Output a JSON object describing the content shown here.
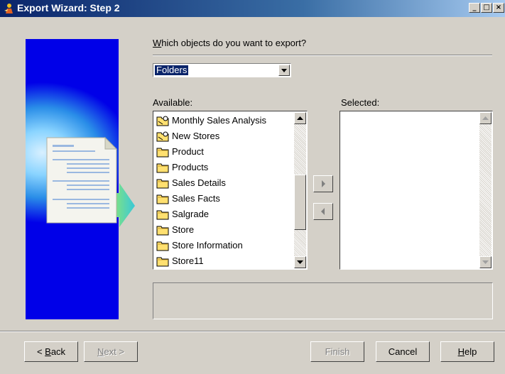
{
  "window": {
    "title": "Export Wizard: Step 2",
    "controls": [
      "minimize",
      "maximize",
      "close"
    ]
  },
  "question": {
    "underline_char": "W",
    "rest": "hich objects do you want to export?"
  },
  "object_type_select": {
    "value": "Folders"
  },
  "available": {
    "label": "Available:",
    "items": [
      {
        "label": "Monthly Sales Analysis",
        "icon": "shared-folder-icon"
      },
      {
        "label": "New Stores",
        "icon": "shared-folder-icon"
      },
      {
        "label": "Product",
        "icon": "folder-icon"
      },
      {
        "label": "Products",
        "icon": "folder-icon"
      },
      {
        "label": "Sales Details",
        "icon": "folder-icon"
      },
      {
        "label": "Sales Facts",
        "icon": "folder-icon"
      },
      {
        "label": "Salgrade",
        "icon": "folder-icon"
      },
      {
        "label": "Store",
        "icon": "folder-icon"
      },
      {
        "label": "Store Information",
        "icon": "folder-icon"
      },
      {
        "label": "Store11",
        "icon": "folder-icon"
      }
    ]
  },
  "selected": {
    "label": "Selected:",
    "items": []
  },
  "buttons": {
    "back_underline": "B",
    "back_rest": "ack",
    "back_prefix": "< ",
    "next_underline": "N",
    "next_rest": "ext >",
    "finish": "Finish",
    "cancel": "Cancel",
    "help_underline": "H",
    "help_rest": "elp"
  },
  "colors": {
    "titlebar_start": "#0a246a",
    "titlebar_end": "#a6caf0",
    "side_panel": "#0000e8",
    "selection": "#0a246a",
    "dialog_face": "#d4d0c8"
  }
}
